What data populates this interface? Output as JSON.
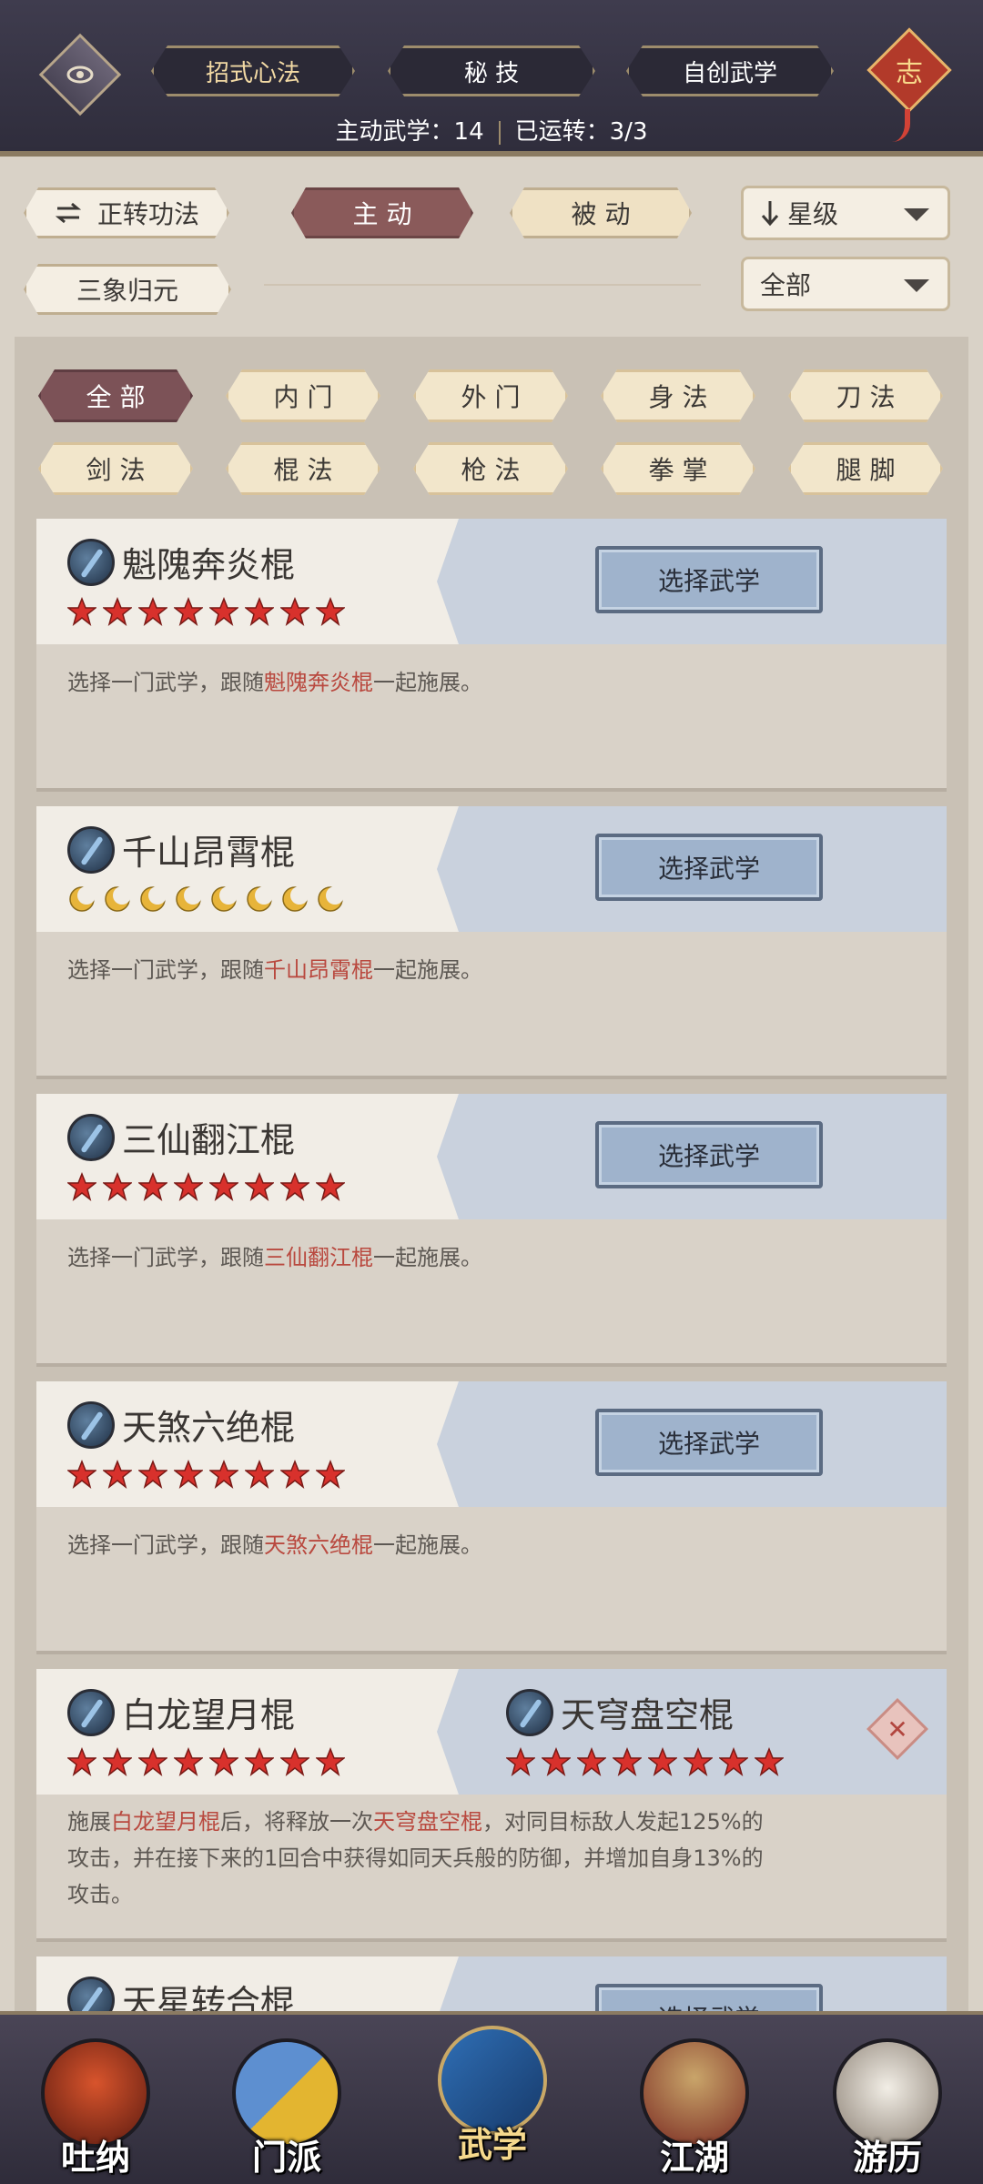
{
  "header": {
    "tabs": [
      {
        "label": "招式心法",
        "active": true
      },
      {
        "label": "秘 技",
        "active": false
      },
      {
        "label": "自创武学",
        "active": false
      }
    ],
    "stat_active_label": "主动武学：",
    "stat_active_value": "14",
    "stat_running_label": "已运转：",
    "stat_running_value": "3/3",
    "badge": "志"
  },
  "filters": {
    "method_label": "正转功法",
    "active_label": "主 动",
    "passive_label": "被 动",
    "sort_label": "星级",
    "scope_label": "全部",
    "combo_label": "三象归元"
  },
  "categories": [
    "全 部",
    "内 门",
    "外 门",
    "身 法",
    "刀 法",
    "剑 法",
    "棍 法",
    "枪 法",
    "拳 掌",
    "腿 脚"
  ],
  "cards": [
    {
      "name": "魁隗奔炎棍",
      "stars": 8,
      "star_type": "star",
      "button": "选择武学",
      "desc_prefix": "选择一门武学，跟随",
      "desc_highlight": "魁隗奔炎棍",
      "desc_suffix": "一起施展。"
    },
    {
      "name": "千山昂霄棍",
      "stars": 8,
      "star_type": "moon",
      "button": "选择武学",
      "desc_prefix": "选择一门武学，跟随",
      "desc_highlight": "千山昂霄棍",
      "desc_suffix": "一起施展。"
    },
    {
      "name": "三仙翻江棍",
      "stars": 8,
      "star_type": "star",
      "button": "选择武学",
      "desc_prefix": "选择一门武学，跟随",
      "desc_highlight": "三仙翻江棍",
      "desc_suffix": "一起施展。"
    },
    {
      "name": "天煞六绝棍",
      "stars": 8,
      "star_type": "star",
      "button": "选择武学",
      "desc_prefix": "选择一门武学，跟随",
      "desc_highlight": "天煞六绝棍",
      "desc_suffix": "一起施展。"
    }
  ],
  "combo_card": {
    "name": "白龙望月棍",
    "partner_name": "天穹盘空棍",
    "stars": 8,
    "partner_stars": 8,
    "desc_1": "施展",
    "desc_hl_1": "白龙望月棍",
    "desc_2": "后，将释放一次",
    "desc_hl_2": "天穹盘空棍",
    "desc_3": "，对同目标敌人发起125%的",
    "desc_line2": "攻击，并在接下来的1回合中获得如同天兵般的防御，并增加自身13%的",
    "desc_line3": "攻击。",
    "close": "✕"
  },
  "partial_card": {
    "name": "天星转合棍",
    "button": "选择武学"
  },
  "nav": [
    {
      "label": "吐纳",
      "icon": "monk-icon",
      "active": false
    },
    {
      "label": "门派",
      "icon": "flags-icon",
      "active": false
    },
    {
      "label": "武学",
      "icon": "book-icon",
      "active": true
    },
    {
      "label": "江湖",
      "icon": "straw-hat-icon",
      "active": false
    },
    {
      "label": "游历",
      "icon": "horse-icon",
      "active": false
    }
  ],
  "colors": {
    "highlight": "#b9493f",
    "star": "#d8312c",
    "moon": "#e7b43a",
    "active_tab": "#8a5a5a"
  }
}
